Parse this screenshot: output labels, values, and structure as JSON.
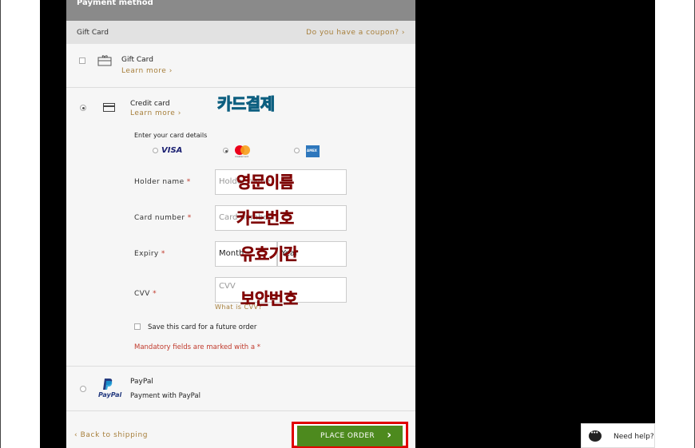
{
  "header": {
    "title": "Payment method"
  },
  "gift_card_bar": {
    "label": "Gift Card",
    "coupon_link": "Do you have a coupon? ›"
  },
  "gift_card": {
    "title": "Gift Card",
    "learn_more": "Learn more ›"
  },
  "credit_card": {
    "title": "Credit card",
    "learn_more": "Learn more ›",
    "enter_details": "Enter your card details",
    "brands": [
      "VISA",
      "mastercard",
      "AMEX"
    ],
    "fields": {
      "holder_label": "Holder name",
      "holder_placeholder": "Holder name",
      "number_label": "Card number",
      "number_placeholder": "Card number",
      "expiry_label": "Expiry",
      "expiry_month": "Month",
      "expiry_year": "Year",
      "cvv_label": "CVV",
      "cvv_placeholder": "CVV",
      "what_is_cvv": "What is CVV?",
      "required_mark": "*"
    },
    "save_card": "Save this card for a future order",
    "mandatory_note": "Mandatory fields are marked with a *"
  },
  "paypal": {
    "title": "PayPal",
    "subtitle": "Payment with PayPal",
    "logo_text": "PayPal"
  },
  "annotations": {
    "card_payment": "카드결제",
    "english_name": "영문이름",
    "card_number": "카드번호",
    "expiry": "유효기간",
    "security_code": "보안번호"
  },
  "footer": {
    "back_link": "‹ Back to shipping",
    "place_order": "PLACE ORDER",
    "arrow": "›"
  },
  "help": {
    "label": "Need help?"
  },
  "colors": {
    "accent": "#a77f3b",
    "place_order_bg": "#4d8a1e",
    "highlight_border": "#e00000",
    "required": "#c0392b"
  }
}
